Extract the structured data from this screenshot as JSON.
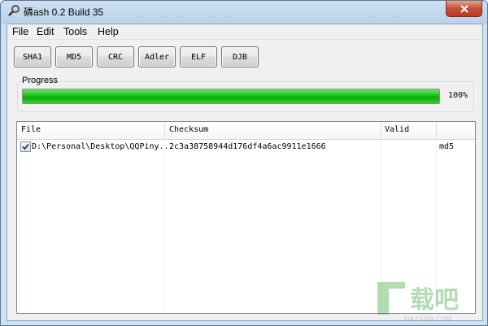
{
  "window": {
    "title": "磷ash 0.2 Build 35"
  },
  "menu": [
    "File",
    "Edit",
    "Tools",
    "Help"
  ],
  "toolbar": [
    "SHA1",
    "MD5",
    "CRC",
    "Adler",
    "ELF",
    "DJB"
  ],
  "progress": {
    "label": "Progress",
    "percent_text": "100%",
    "value": 1.0,
    "color": "#0db10d"
  },
  "list": {
    "columns": [
      "File",
      "Checksum",
      "Valid"
    ],
    "rows": [
      {
        "checked": true,
        "file": "D:\\Personal\\Desktop\\QQPiny...",
        "checksum": "2c3a38758944d176df4a6ac9911e1666",
        "valid": "",
        "type": "md5"
      }
    ]
  },
  "watermark": {
    "text": "XIAZAIBA.COM"
  }
}
